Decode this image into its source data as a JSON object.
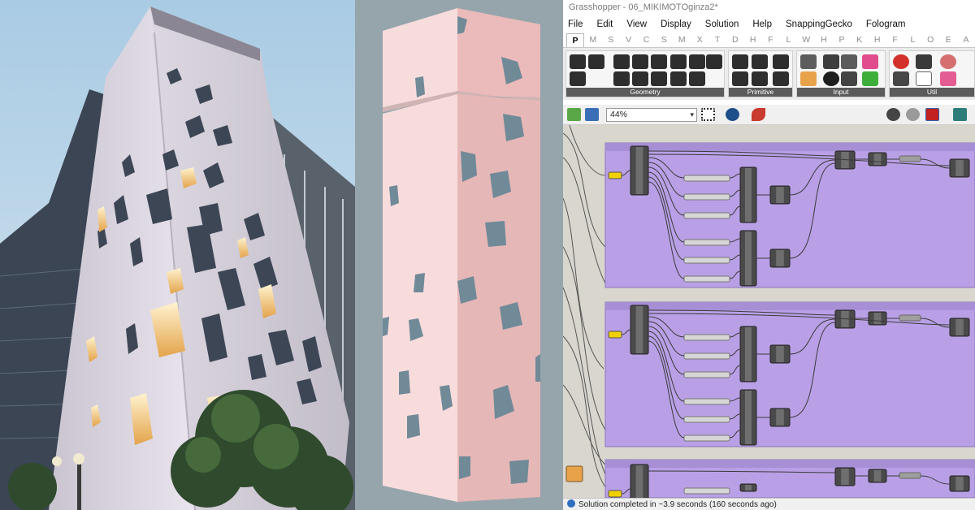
{
  "window": {
    "title": "Grasshopper - 06_MIKIMOTOginza2*"
  },
  "menu": [
    "File",
    "Edit",
    "View",
    "Display",
    "Solution",
    "Help",
    "SnappingGecko",
    "Fologram"
  ],
  "tabs": [
    "P",
    "M",
    "S",
    "V",
    "C",
    "S",
    "M",
    "X",
    "T",
    "D",
    "H",
    "F",
    "L",
    "W",
    "H",
    "P",
    "K",
    "H",
    "F",
    "L",
    "O",
    "E",
    "A"
  ],
  "active_tab": "P",
  "ribbon_groups": [
    "Geometry",
    "Primitive",
    "Input",
    "Util"
  ],
  "toolbar": {
    "zoom": "44%"
  },
  "status": {
    "text": "Solution completed in ~3.9 seconds (160 seconds ago)"
  },
  "colors": {
    "canvas": "#d9d6ce",
    "group_fill": "#b9a0e6",
    "render_bg": "#95a5ab",
    "facade_light": "#f7d9d9",
    "facade_shade": "#e7b8b8",
    "opening": "#6f8796",
    "toggle": "#f0d000"
  }
}
